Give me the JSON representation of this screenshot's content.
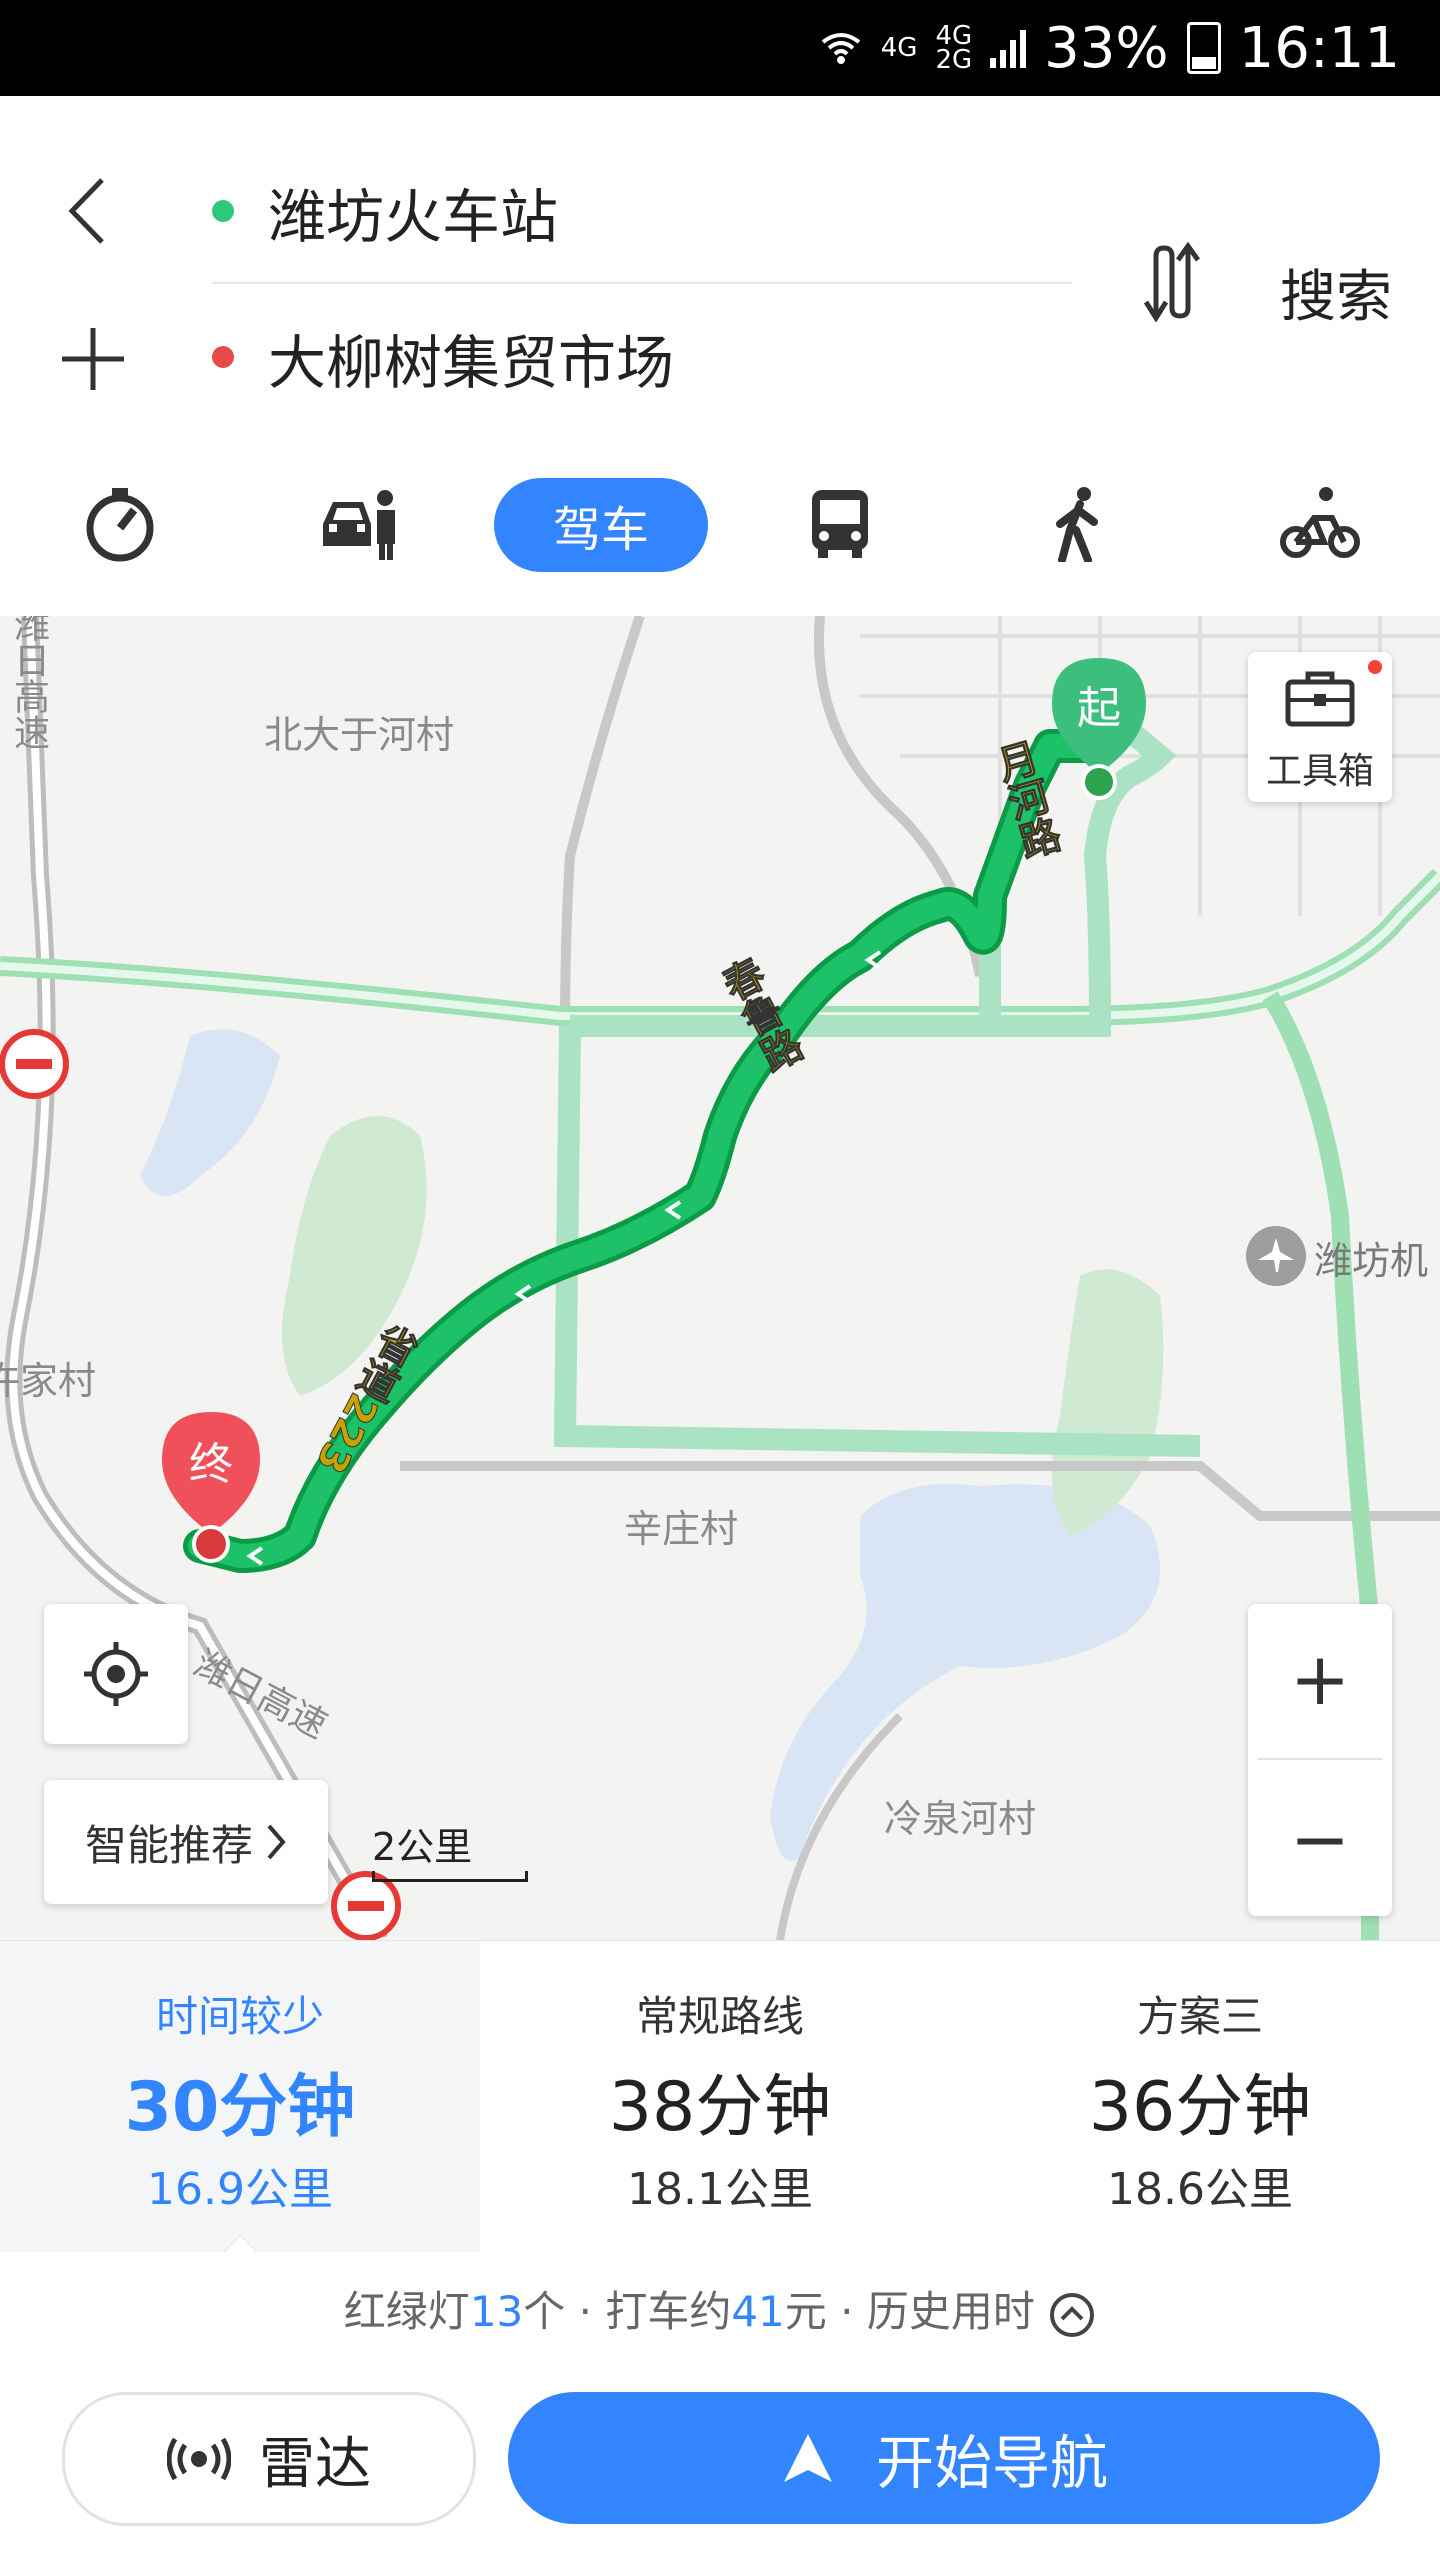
{
  "status_bar": {
    "network_1": "4G",
    "network_2": "4G\n2G",
    "battery": "33%",
    "time": "16:11"
  },
  "route": {
    "origin": "潍坊火车站",
    "destination": "大柳树集贸市场",
    "search_label": "搜索",
    "colors": {
      "origin": "#2fc77a",
      "destination": "#e84a4a"
    }
  },
  "tabs": {
    "active_label": "驾车",
    "icons": [
      "recommend-clock-icon",
      "taxi-icon",
      "bus-icon",
      "walk-icon",
      "bike-icon"
    ]
  },
  "map": {
    "toolbox_label": "工具箱",
    "start_marker": "起",
    "end_marker": "终",
    "smart_recommend": "智能推荐",
    "scale_label": "2公里",
    "zoom_in": "+",
    "zoom_out": "−",
    "place_labels": {
      "village_north": "北大于河村",
      "village_west": "许家村",
      "village_xinzhuang": "辛庄村",
      "village_lengquan": "冷泉河村",
      "airport": "潍坊机",
      "highway_top": "潍日高速",
      "highway_bottom": "潍日高速"
    },
    "road_labels": {
      "yuehe": "月河路",
      "chunlu": "春鲁路",
      "provincial": "省道223"
    }
  },
  "route_options": [
    {
      "name": "时间较少",
      "time": "30分钟",
      "distance": "16.9公里",
      "active": true
    },
    {
      "name": "常规路线",
      "time": "38分钟",
      "distance": "18.1公里",
      "active": false
    },
    {
      "name": "方案三",
      "time": "36分钟",
      "distance": "18.6公里",
      "active": false
    }
  ],
  "summary": {
    "lights_prefix": "红绿灯",
    "lights_count": "13",
    "lights_suffix": "个 · 打车约",
    "taxi_fare": "41",
    "taxi_suffix": "元 · 历史用时"
  },
  "actions": {
    "radar_label": "雷达",
    "navigate_label": "开始导航"
  }
}
